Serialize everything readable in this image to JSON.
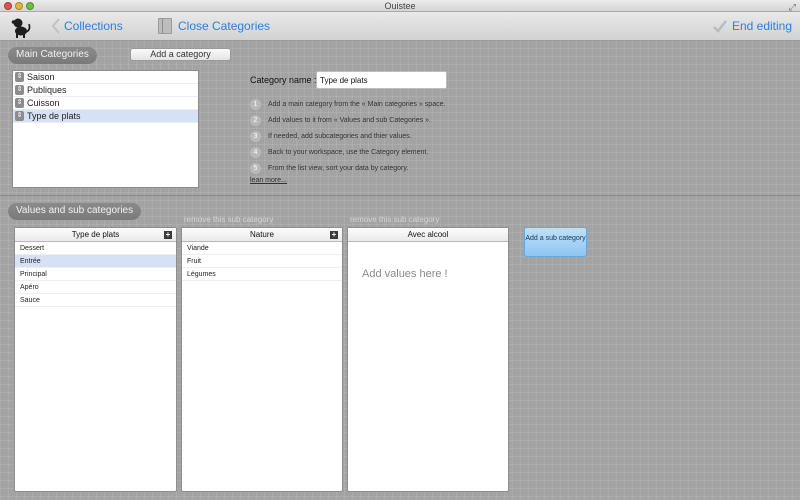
{
  "window": {
    "title": "Ouistee"
  },
  "toolbar": {
    "back_label": "Collections",
    "close_label": "Close Categories",
    "end_label": "End editing",
    "accent": "#2f7fd6"
  },
  "main_categories": {
    "section_label": "Main Categories",
    "add_button": "Add a category",
    "items": [
      "Saison",
      "Publiques",
      "Cuisson",
      "Type de plats"
    ],
    "selected_index": 3
  },
  "category_name": {
    "label": "Category name :",
    "value": "Type de plats"
  },
  "steps": [
    {
      "num": "1",
      "text": "Add a main category from the « Main categories » space."
    },
    {
      "num": "2",
      "text": "Add values to it from « Values and sub Categories »."
    },
    {
      "num": "3",
      "text": "If needed, add subcategories and thier values."
    },
    {
      "num": "4",
      "text": "Back to your workspace, use the Category element."
    },
    {
      "num": "5",
      "text": "From the list view, sort your data by category."
    }
  ],
  "learn_more": "lean more...",
  "values": {
    "section_label": "Values and sub categories",
    "remove_link": "remove this sub category",
    "add_sub_button": "Add a sub category",
    "columns": [
      {
        "header": "Type de plats",
        "items": [
          "Dessert",
          "Entrée",
          "Principal",
          "Apéro",
          "Sauce"
        ],
        "selected_index": 1
      },
      {
        "header": "Nature",
        "items": [
          "Viande",
          "Fruit",
          "Légumes"
        ]
      },
      {
        "header": "Avec alcool",
        "placeholder": "Add values here !"
      }
    ]
  }
}
